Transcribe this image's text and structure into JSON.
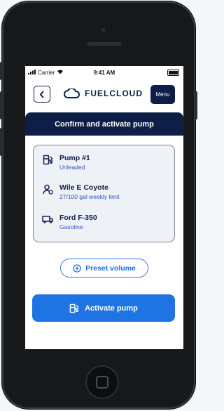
{
  "status_bar": {
    "carrier": "Carrier",
    "time": "9:41 AM"
  },
  "header": {
    "brand": "FUELCLOUD",
    "menu_label": "Menu",
    "back_icon": "chevron-left-icon"
  },
  "banner": {
    "title": "Confirm and activate pump"
  },
  "details": {
    "pump": {
      "title": "Pump #1",
      "subtitle": "Unleaded",
      "icon": "fuel-pump-icon"
    },
    "driver": {
      "title": "Wile E Coyote",
      "subtitle": "27/100 gal weekly limit",
      "icon": "user-icon"
    },
    "vehicle": {
      "title": "Ford F-350",
      "subtitle": "Gasoline",
      "icon": "truck-icon"
    }
  },
  "actions": {
    "preset_label": "Preset volume",
    "activate_label": "Activate pump"
  },
  "colors": {
    "navy": "#0e1f47",
    "accent_blue": "#1f74e4",
    "link_blue": "#2f56c6"
  }
}
